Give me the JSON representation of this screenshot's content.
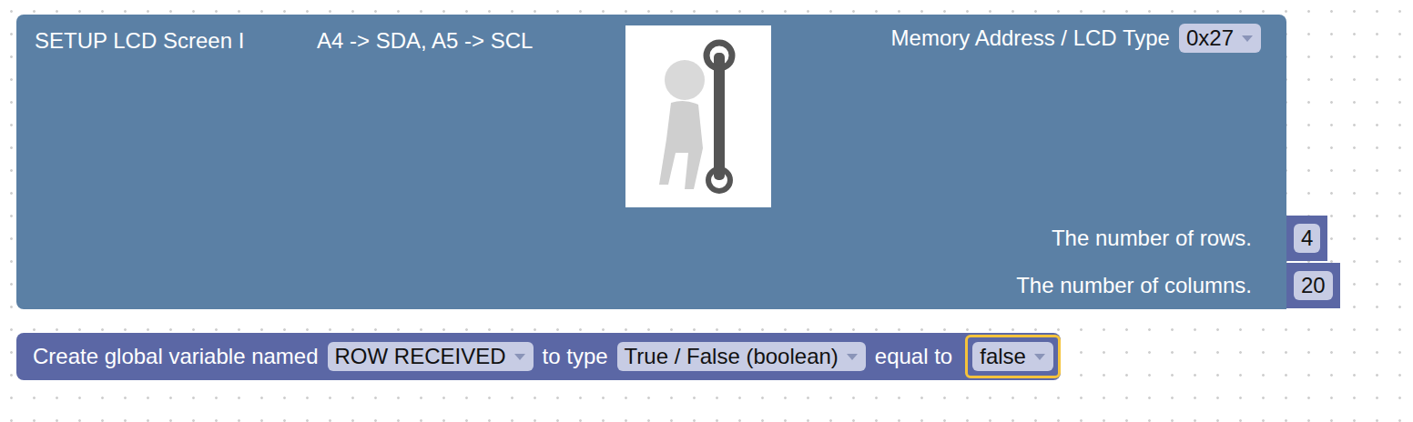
{
  "setup_block": {
    "title": "SETUP LCD Screen I",
    "pins": "A4 -> SDA, A5 -> SCL",
    "address_label": "Memory Address / LCD Type",
    "address": "0x27"
  },
  "inputs": [
    {
      "label": "The number of rows.",
      "value": "4"
    },
    {
      "label": "The number of columns.",
      "value": "20"
    }
  ],
  "variable_block": {
    "prefix": "Create global variable named",
    "name": "ROW RECEIVED",
    "type_label": "to type",
    "type": "True / False (boolean)",
    "equal_label": "equal to",
    "value": "false",
    "value_selected": true
  }
}
